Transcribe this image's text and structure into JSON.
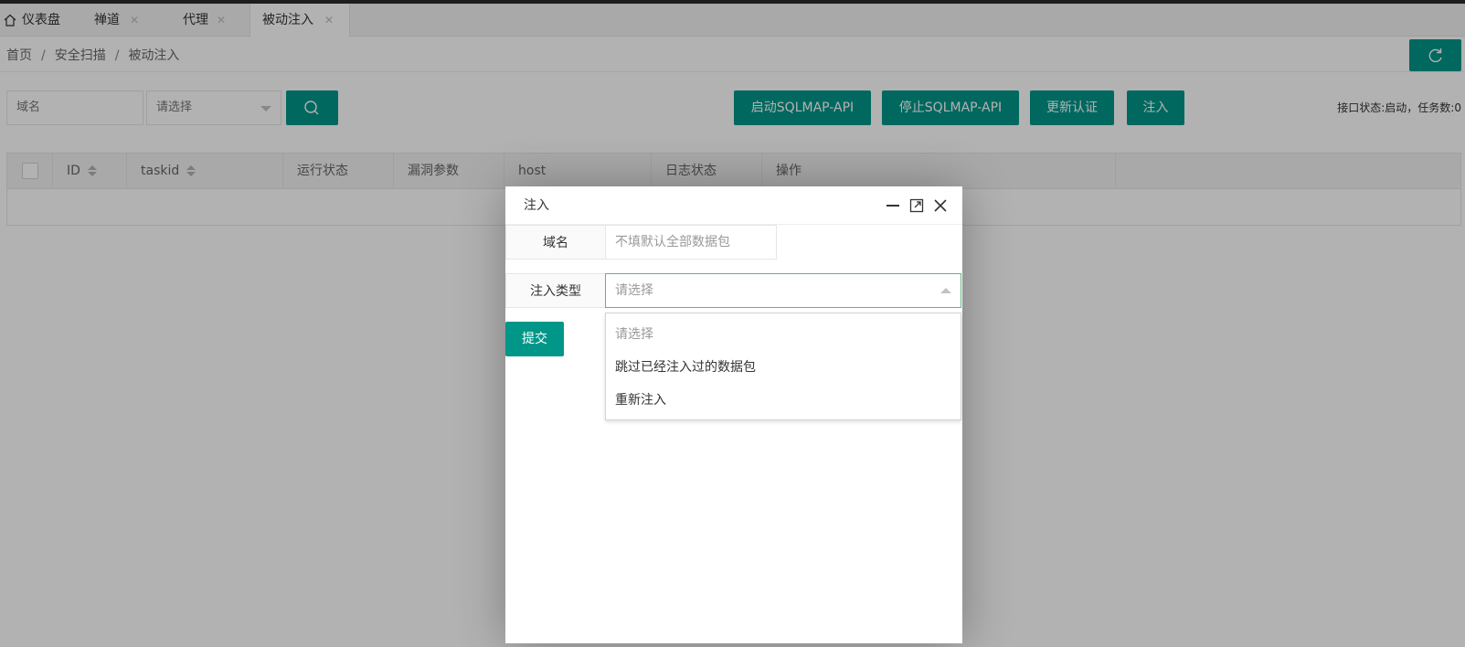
{
  "tabs": [
    {
      "label": "仪表盘",
      "closable": false,
      "active": false
    },
    {
      "label": "禅道",
      "closable": true,
      "active": false
    },
    {
      "label": "代理",
      "closable": true,
      "active": false
    },
    {
      "label": "被动注入",
      "closable": true,
      "active": true
    }
  ],
  "breadcrumb": {
    "items": [
      "首页",
      "安全扫描",
      "被动注入"
    ],
    "separator": "/"
  },
  "search": {
    "domain_placeholder": "域名",
    "select_placeholder": "请选择"
  },
  "toolbar": {
    "start_label": "启动SQLMAP-API",
    "stop_label": "停止SQLMAP-API",
    "update_auth_label": "更新认证",
    "inject_label": "注入"
  },
  "status": {
    "text": "接口状态:启动，任务数:0"
  },
  "table": {
    "columns": [
      "ID",
      "taskid",
      "运行状态",
      "漏洞参数",
      "host",
      "日志状态",
      "操作"
    ],
    "rows": []
  },
  "modal": {
    "title": "注入",
    "domain_label": "域名",
    "domain_placeholder": "不填默认全部数据包",
    "type_label": "注入类型",
    "type_placeholder": "请选择",
    "submit_label": "提交",
    "options": [
      "请选择",
      "跳过已经注入过的数据包",
      "重新注入"
    ]
  },
  "colors": {
    "primary": "#009688",
    "focus_border": "#5fb878",
    "overlay": "rgba(0,0,0,0.3)"
  },
  "icons": {
    "home": "home-icon",
    "close": "close-icon",
    "refresh": "refresh-icon",
    "search": "search-icon",
    "minimize": "minimize-icon",
    "maximize": "maximize-icon"
  }
}
